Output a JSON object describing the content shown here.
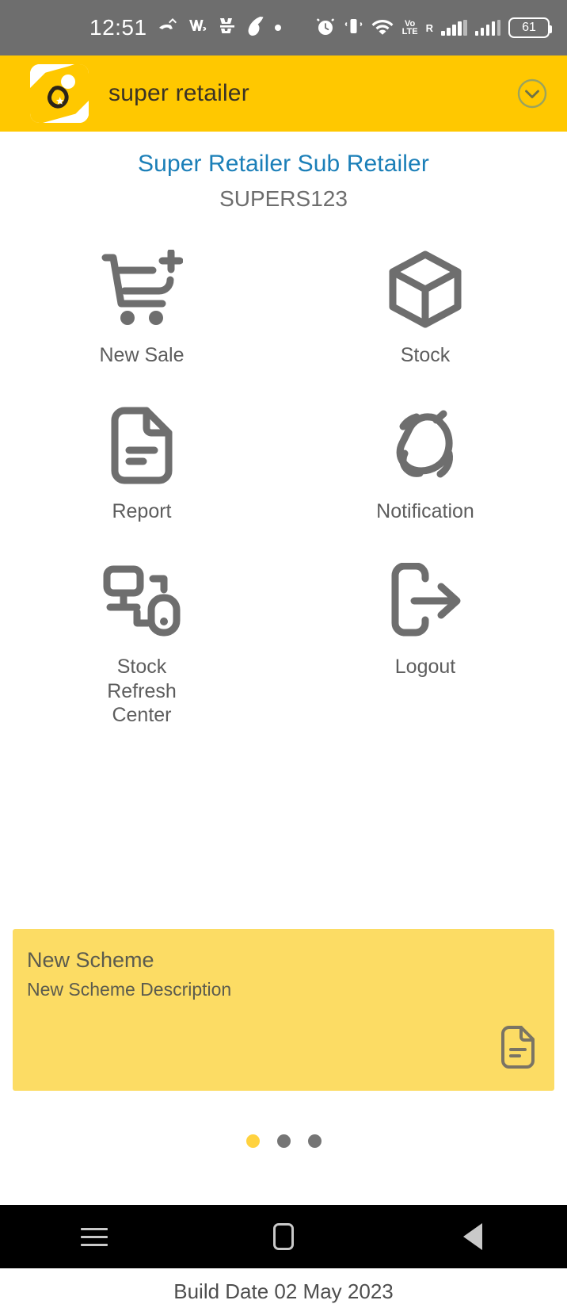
{
  "status_bar": {
    "time": "12:51",
    "battery_percent": "61",
    "volte_line1": "Vo",
    "volte_line2": "LTE",
    "roaming_letter": "R",
    "icons": [
      "missed-call-icon",
      "whatsapp-business-icon",
      "aaj-tak-icon",
      "airtel-icon",
      "generic-dot-icon",
      "alarm-icon",
      "vibrate-icon",
      "wifi-icon",
      "volte-icon",
      "signal-bars-icon",
      "signal-bars-2-icon",
      "battery-icon"
    ]
  },
  "app_bar": {
    "title": "super retailer",
    "logo_name": "app-logo",
    "expand_icon": "chevron-down-circle-icon"
  },
  "header": {
    "title": "Super Retailer Sub Retailer",
    "subtitle": "SUPERS123",
    "title_color": "#1b7fb8",
    "subtitle_color": "#6d6d6d"
  },
  "menu": {
    "tiles": [
      {
        "label": "New Sale",
        "icon": "cart-plus-icon"
      },
      {
        "label": "Stock",
        "icon": "cube-box-icon"
      },
      {
        "label": "Report",
        "icon": "document-lines-icon"
      },
      {
        "label": "Notification",
        "icon": "bell-ringing-icon"
      },
      {
        "label": "Stock\nRefresh\nCenter",
        "icon": "device-sync-icon"
      },
      {
        "label": "Logout",
        "icon": "logout-arrow-icon"
      }
    ]
  },
  "scheme_card": {
    "title": "New Scheme",
    "description": "New Scheme Description",
    "icon": "document-lines-icon",
    "background": "#FCDC64"
  },
  "carousel": {
    "total": 3,
    "active_index": 0,
    "active_color": "#FFD23F",
    "inactive_color": "#757575"
  },
  "footer": {
    "build_date": "Build Date 02 May 2023"
  },
  "nav_bar": {
    "recents": "recents-icon",
    "home": "home-icon",
    "back": "back-icon"
  }
}
